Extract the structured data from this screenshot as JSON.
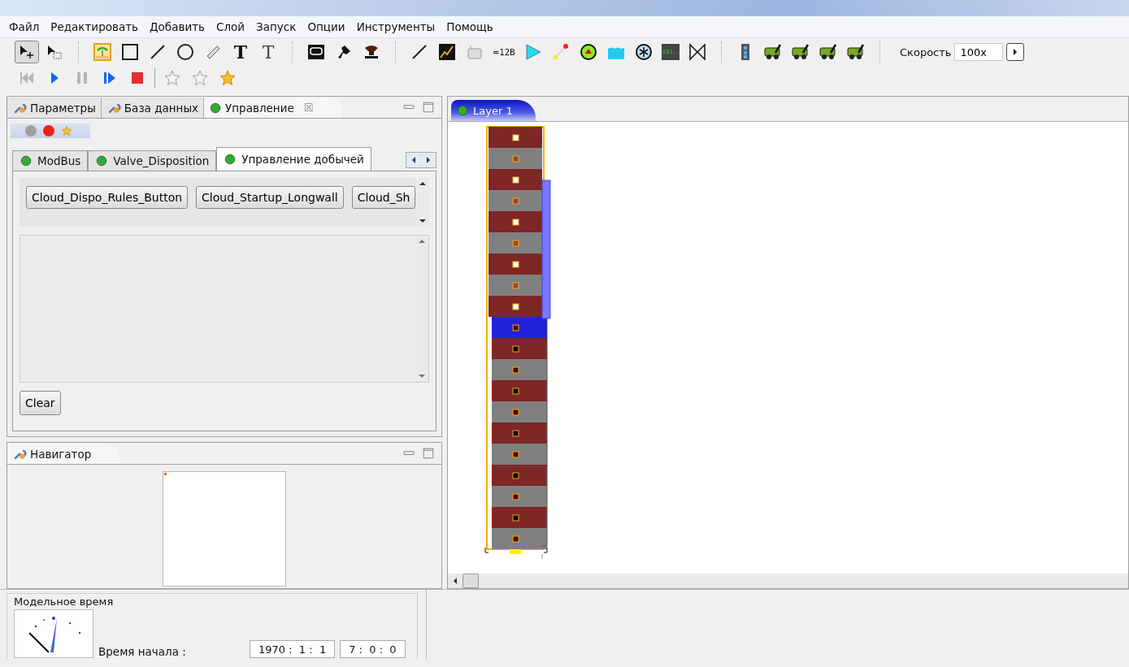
{
  "menu": [
    {
      "label": "Файл"
    },
    {
      "label": "Редактировать"
    },
    {
      "label": "Добавить"
    },
    {
      "label": "Слой"
    },
    {
      "label": "Запуск"
    },
    {
      "label": "Опции"
    },
    {
      "label": "Инструменты"
    },
    {
      "label": "Помощь"
    }
  ],
  "toolbar": [
    {
      "kind": "select",
      "selected": true
    },
    {
      "kind": "marquee",
      "selected": false
    },
    {
      "kind": "sep"
    },
    {
      "kind": "image",
      "selected": false
    },
    {
      "kind": "rect",
      "selected": false
    },
    {
      "kind": "line",
      "selected": false
    },
    {
      "kind": "circle",
      "selected": false
    },
    {
      "kind": "ruler",
      "selected": false
    },
    {
      "kind": "text",
      "label": "T",
      "selected": false
    },
    {
      "kind": "text-light",
      "label": "T",
      "selected": false
    },
    {
      "kind": "sep"
    },
    {
      "kind": "conveyor",
      "selected": false
    },
    {
      "kind": "shearer",
      "selected": false
    },
    {
      "kind": "support",
      "selected": false
    },
    {
      "kind": "sep"
    },
    {
      "kind": "line",
      "selected": false
    },
    {
      "kind": "chart",
      "selected": false
    },
    {
      "kind": "machine",
      "selected": false
    },
    {
      "kind": "small-text",
      "label": "=12B",
      "selected": false
    },
    {
      "kind": "triangle",
      "selected": false
    },
    {
      "kind": "pen",
      "selected": false
    },
    {
      "kind": "round",
      "selected": false
    },
    {
      "kind": "water",
      "selected": false
    },
    {
      "kind": "asterisk",
      "selected": false
    },
    {
      "kind": "display",
      "label": "101…",
      "selected": false
    },
    {
      "kind": "valve",
      "selected": false
    },
    {
      "kind": "sep"
    },
    {
      "kind": "film",
      "selected": false
    },
    {
      "kind": "truck",
      "selected": false
    },
    {
      "kind": "truck",
      "selected": false
    },
    {
      "kind": "truck",
      "selected": false
    },
    {
      "kind": "truck",
      "selected": false
    },
    {
      "kind": "sep"
    }
  ],
  "speed": {
    "label": "Скорость",
    "value": "100x"
  },
  "run_toolbar": [
    {
      "kind": "first",
      "disabled": true
    },
    {
      "kind": "play",
      "disabled": false
    },
    {
      "kind": "pause",
      "disabled": true
    },
    {
      "kind": "step",
      "disabled": false
    },
    {
      "kind": "stop",
      "disabled": false
    },
    {
      "kind": "sep"
    },
    {
      "kind": "star-outline",
      "disabled": false
    },
    {
      "kind": "star-outline",
      "disabled": false
    },
    {
      "kind": "star",
      "disabled": false
    }
  ],
  "left_tabs": [
    {
      "label": "Параметры",
      "kind": "settings",
      "selected": false
    },
    {
      "label": "База данных",
      "kind": "settings",
      "selected": false
    },
    {
      "label": "Управление",
      "kind": "control",
      "selected": true,
      "close": "☒"
    }
  ],
  "status_dots": [
    {
      "color": "#a0a0a0"
    },
    {
      "color": "#ee2211"
    }
  ],
  "inner_tabs": [
    {
      "label": "ModBus",
      "selected": false
    },
    {
      "label": "Valve_Disposition",
      "selected": false
    },
    {
      "label": "Управление добычей",
      "selected": true
    }
  ],
  "command_buttons": [
    "Cloud_Dispo_Rules_Button",
    "Cloud_Startup_Longwall",
    "Cloud_Sh"
  ],
  "clear_button": "Clear",
  "navigator": {
    "title": "Навигатор"
  },
  "editor_tabs": [
    {
      "label": "Layer 1",
      "selected": true
    }
  ],
  "model_time": {
    "title": "Модельное время",
    "start_label": "Время начала :",
    "date": "1970 :  1 :  1",
    "time": "7 :  0 :  0"
  }
}
